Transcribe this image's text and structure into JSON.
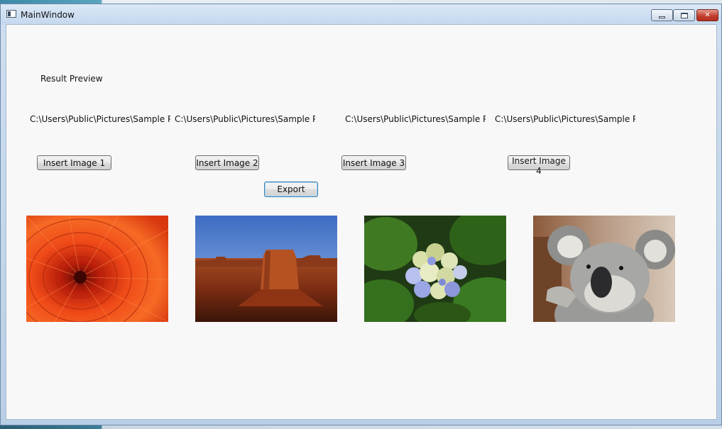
{
  "window": {
    "title": "MainWindow",
    "controls": {
      "minimize": "minimize",
      "maximize": "maximize",
      "close": "✕"
    }
  },
  "content": {
    "result_preview_label": "Result Preview",
    "paths": [
      "C:\\Users\\Public\\Pictures\\Sample Pictures\\Chrysanthemum.jpg",
      "C:\\Users\\Public\\Pictures\\Sample Pictures\\Desert.jpg",
      "C:\\Users\\Public\\Pictures\\Sample Pictures\\Hydrangeas.jpg",
      "C:\\Users\\Public\\Pictures\\Sample Pictures\\Koala.jpg"
    ],
    "buttons": {
      "insert_1": "Insert Image 1",
      "insert_2": "Insert Image 2",
      "insert_3": "Insert Image 3",
      "insert_4": "Insert Image 4",
      "export": "Export"
    },
    "images": [
      {
        "subject": "orange chrysanthemum flower",
        "accent": "#e8461a"
      },
      {
        "subject": "desert mesa landscape",
        "accent": "#b8481c"
      },
      {
        "subject": "hydrangea flowers",
        "accent": "#9aa6e0"
      },
      {
        "subject": "koala",
        "accent": "#8c8c8c"
      }
    ]
  },
  "colors": {
    "client_background": "#f9f8f8",
    "titlebar": "#c4d8ee",
    "close_button": "#c0392b"
  }
}
